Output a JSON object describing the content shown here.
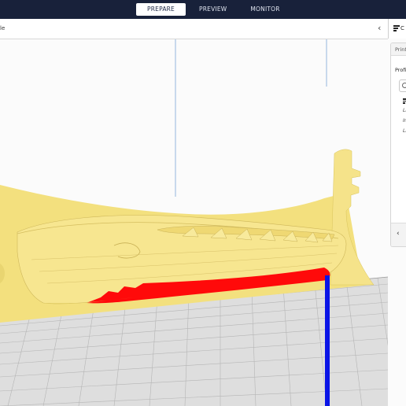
{
  "stages": [
    {
      "label": "PREPARE",
      "active": true
    },
    {
      "label": "PREVIEW",
      "active": false
    },
    {
      "label": "MONITOR",
      "active": false
    }
  ],
  "object_list": {
    "name_fragment": "le",
    "collapse_icon": "chevron-left-icon"
  },
  "settings_panel": {
    "header_fragment": "C",
    "tab_fragment": "Print",
    "profile_fragment": "Profi",
    "search_icon": "search-icon",
    "rows": [
      "Li",
      "Ir",
      "Li"
    ],
    "back_icon": "chevron-left-icon"
  },
  "colors": {
    "topbar": "#18213a",
    "model": "#f6e58a",
    "overhang": "#ff0a0a",
    "z_axis": "#0a14e6",
    "build_volume": "#7aa6d6"
  }
}
